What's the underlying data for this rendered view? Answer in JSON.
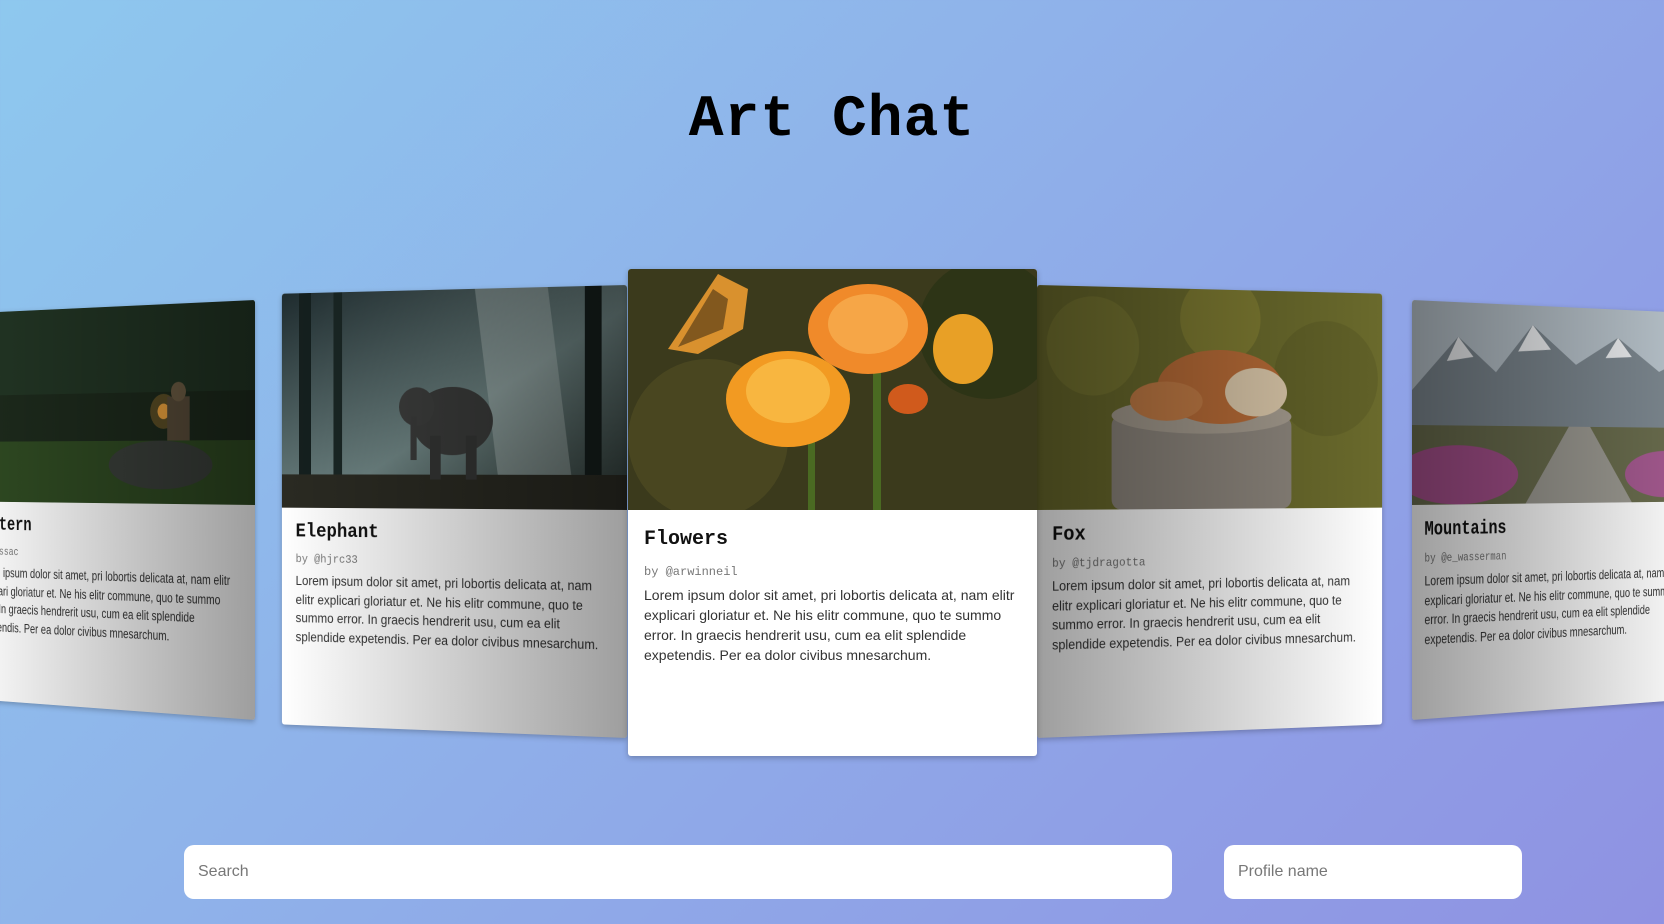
{
  "app": {
    "title": "Art Chat"
  },
  "cards": [
    {
      "title": "Lantern",
      "author": "olanissac",
      "description": "Lorem ipsum dolor sit amet, pri lobortis delicata at, nam elitr explicari gloriatur et. Ne his elitr commune, quo te summo error. In graecis hendrerit usu, cum ea elit splendide expetendis. Per ea dolor civibus mnesarchum.",
      "image_icon": "boy-with-lantern-image"
    },
    {
      "title": "Elephant",
      "author": "by @hjrc33",
      "description": "Lorem ipsum dolor sit amet, pri lobortis delicata at, nam elitr explicari gloriatur et. Ne his elitr commune, quo te summo error. In graecis hendrerit usu, cum ea elit splendide expetendis. Per ea dolor civibus mnesarchum.",
      "image_icon": "elephant-in-forest-image"
    },
    {
      "title": "Flowers",
      "author": "by @arwinneil",
      "description": "Lorem ipsum dolor sit amet, pri lobortis delicata at, nam elitr explicari gloriatur et. Ne his elitr commune, quo te summo error. In graecis hendrerit usu, cum ea elit splendide expetendis. Per ea dolor civibus mnesarchum.",
      "image_icon": "flowers-with-butterfly-image"
    },
    {
      "title": "Fox",
      "author": "by @tjdragotta",
      "description": "Lorem ipsum dolor sit amet, pri lobortis delicata at, nam elitr explicari gloriatur et. Ne his elitr commune, quo te summo error. In graecis hendrerit usu, cum ea elit splendide expetendis. Per ea dolor civibus mnesarchum.",
      "image_icon": "sleeping-fox-image"
    },
    {
      "title": "Mountains",
      "author": "by @e_wasserman",
      "description": "Lorem ipsum dolor sit amet, pri lobortis delicata at, nam elitr explicari gloriatur et. Ne his elitr commune, quo te summo error. In graecis hendrerit usu, cum ea elit splendide expetendis. Per ea dolor civibus mnesarchum.",
      "image_icon": "mountain-path-image"
    }
  ],
  "search": {
    "placeholder": "Search"
  },
  "profile": {
    "placeholder": "Profile name"
  }
}
